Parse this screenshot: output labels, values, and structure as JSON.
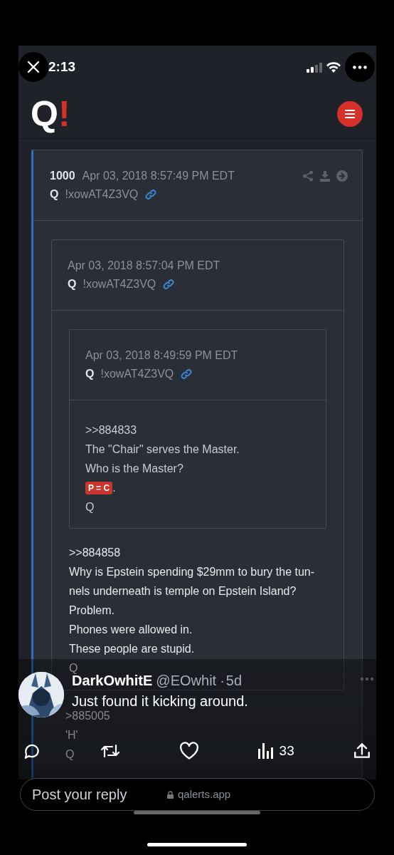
{
  "status_bar": {
    "time": "2:13"
  },
  "site": {
    "logo": "Q",
    "logo_mark": "!"
  },
  "post": {
    "number": "1000",
    "date": "Apr 03, 2018 8:57:49 PM EDT",
    "author": "Q",
    "trip": "!xowAT4Z3VQ",
    "quote": {
      "date": "Apr 03, 2018 8:57:04 PM EDT",
      "author": "Q",
      "trip": "!xowAT4Z3VQ",
      "quote": {
        "date": "Apr 03, 2018 8:49:59 PM EDT",
        "author": "Q",
        "trip": "!xowAT4Z3VQ",
        "lines": [
          {
            "kind": "text",
            "text": ">>884833"
          },
          {
            "kind": "text",
            "text": "The \"Chair\" serves the Master."
          },
          {
            "kind": "text",
            "text": "Who is the Master?"
          },
          {
            "kind": "tag",
            "text": "P = C",
            "after": "."
          },
          {
            "kind": "text",
            "text": "Q"
          }
        ]
      },
      "lines": [
        {
          "kind": "text",
          "text": ">>884858"
        },
        {
          "kind": "text",
          "text": "Why is Epstein spending $29mm to bury the tun-"
        },
        {
          "kind": "text",
          "text": "nels underneath is temple on Epstein Island?"
        },
        {
          "kind": "text",
          "text": "Problem."
        },
        {
          "kind": "text",
          "text": "Phones were allowed in."
        },
        {
          "kind": "text",
          "text": "These people are stupid."
        },
        {
          "kind": "text",
          "text": "Q"
        }
      ]
    },
    "lines": [
      {
        "kind": "text",
        "text": ">885005"
      },
      {
        "kind": "text",
        "text": "'H'"
      },
      {
        "kind": "text",
        "text": "Q"
      }
    ]
  },
  "tweet": {
    "name": "DarkOwhitE",
    "handle": "@EOwhit",
    "separator": "·",
    "time": "5d",
    "text": "Just found it kicking around.",
    "views": "33"
  },
  "reply": {
    "placeholder": "Post your reply",
    "url": "qalerts.app"
  }
}
